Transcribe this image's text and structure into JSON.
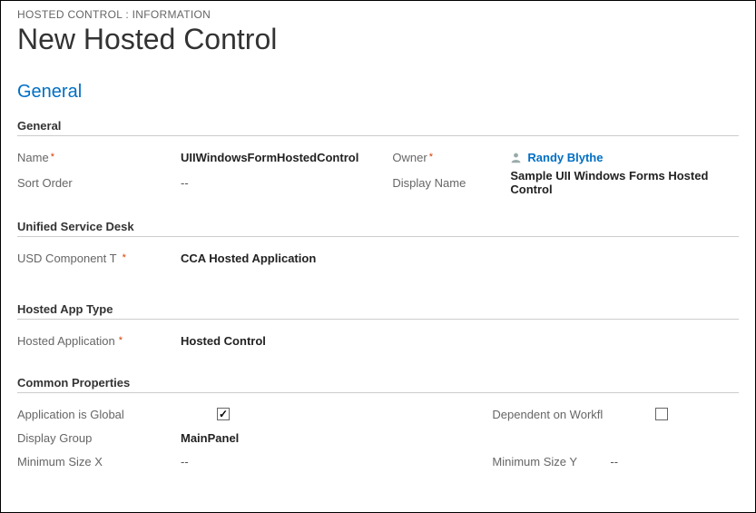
{
  "breadcrumb": "HOSTED CONTROL : INFORMATION",
  "pageTitle": "New Hosted Control",
  "mainSection": "General",
  "subsections": {
    "general": {
      "title": "General",
      "name": {
        "label": "Name",
        "value": "UIIWindowsFormHostedControl",
        "required": true
      },
      "sortOrder": {
        "label": "Sort Order",
        "value": "--"
      },
      "owner": {
        "label": "Owner",
        "value": "Randy Blythe",
        "required": true
      },
      "displayName": {
        "label": "Display Name",
        "value": "Sample UII Windows Forms Hosted Control"
      }
    },
    "usd": {
      "title": "Unified Service Desk",
      "componentType": {
        "label": "USD Component T",
        "value": "CCA Hosted Application",
        "required": true
      }
    },
    "hostedAppType": {
      "title": "Hosted App Type",
      "hostedApplication": {
        "label": "Hosted Application",
        "value": "Hosted Control",
        "required": true
      }
    },
    "common": {
      "title": "Common Properties",
      "appGlobal": {
        "label": "Application is Global",
        "checked": true
      },
      "dependentWorkflow": {
        "label": "Dependent on Workfl",
        "checked": false
      },
      "displayGroup": {
        "label": "Display Group",
        "value": "MainPanel"
      },
      "minX": {
        "label": "Minimum Size X",
        "value": "--"
      },
      "minY": {
        "label": "Minimum Size Y",
        "value": "--"
      }
    }
  }
}
